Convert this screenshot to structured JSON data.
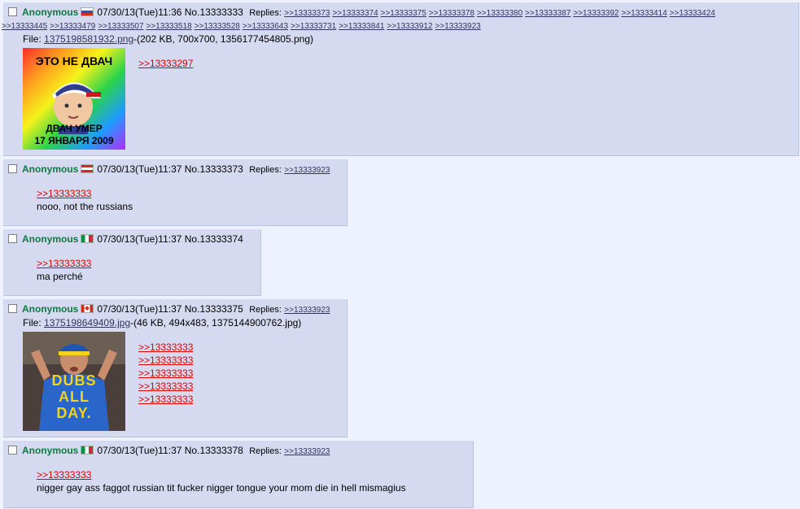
{
  "posts": [
    {
      "name": "Anonymous",
      "datetime": "07/30/13(Tue)11:36",
      "number": "No.13333333",
      "replies_label": "Replies:",
      "replies": [
        "&gt;&gt;13333373"
      ],
      "replies_line1": [
        ">>13333373",
        ">>13333374",
        ">>13333375",
        ">>13333378",
        ">>13333380",
        ">>13333387",
        ">>13333392",
        ">>13333414",
        ">>13333424"
      ],
      "replies_line2": [
        ">>13333445",
        ">>13333479",
        ">>13333507",
        ">>13333518",
        ">>13333528",
        ">>13333643",
        ">>13333731",
        ">>13333841",
        ">>13333912",
        ">>13333923"
      ],
      "file_label": "File:",
      "file_name": "1375198581932.png",
      "file_info": "-(202 KB, 700x700, 1356177454805.png)",
      "image_top_text": "ЭТО НЕ ДВАЧ",
      "image_bottom_text1": "ДВАЧ УМЕР",
      "image_bottom_text2": "17 ЯНВАРЯ 2009",
      "quotes": [
        ">>13333297"
      ]
    },
    {
      "name": "Anonymous",
      "datetime": "07/30/13(Tue)11:37",
      "number": "No.13333373",
      "replies_label": "Replies:",
      "replies": [
        ">>13333923"
      ],
      "quote": ">>13333333",
      "text": "nooo, not the russians"
    },
    {
      "name": "Anonymous",
      "datetime": "07/30/13(Tue)11:37",
      "number": "No.13333374",
      "quote": ">>13333333",
      "text": "ma perché"
    },
    {
      "name": "Anonymous",
      "datetime": "07/30/13(Tue)11:37",
      "number": "No.13333375",
      "replies_label": "Replies:",
      "replies": [
        ">>13333923"
      ],
      "file_label": "File:",
      "file_name": "1375198649409.jpg",
      "file_info": "-(46 KB, 494x483, 1375144900762.jpg)",
      "image_text1": "DUBS",
      "image_text2": "ALL",
      "image_text3": "DAY.",
      "quotes": [
        ">>13333333",
        ">>13333333",
        ">>13333333",
        ">>13333333",
        ">>13333333"
      ]
    },
    {
      "name": "Anonymous",
      "datetime": "07/30/13(Tue)11:37",
      "number": "No.13333378",
      "replies_label": "Replies:",
      "replies": [
        ">>13333923"
      ],
      "quote": ">>13333333",
      "text": "nigger gay ass faggot russian tit fucker nigger tongue your mom die in hell mismagius"
    }
  ],
  "colors": {
    "page_bg": "#eef2ff",
    "post_bg": "#d6daf0",
    "name": "#117743",
    "quote": "#dd0000",
    "link": "#34345c"
  },
  "icons": {
    "flags": [
      "russia-flag-icon",
      "austria-flag-icon",
      "italy-flag-icon",
      "canada-flag-icon",
      "italy-flag-icon"
    ]
  }
}
